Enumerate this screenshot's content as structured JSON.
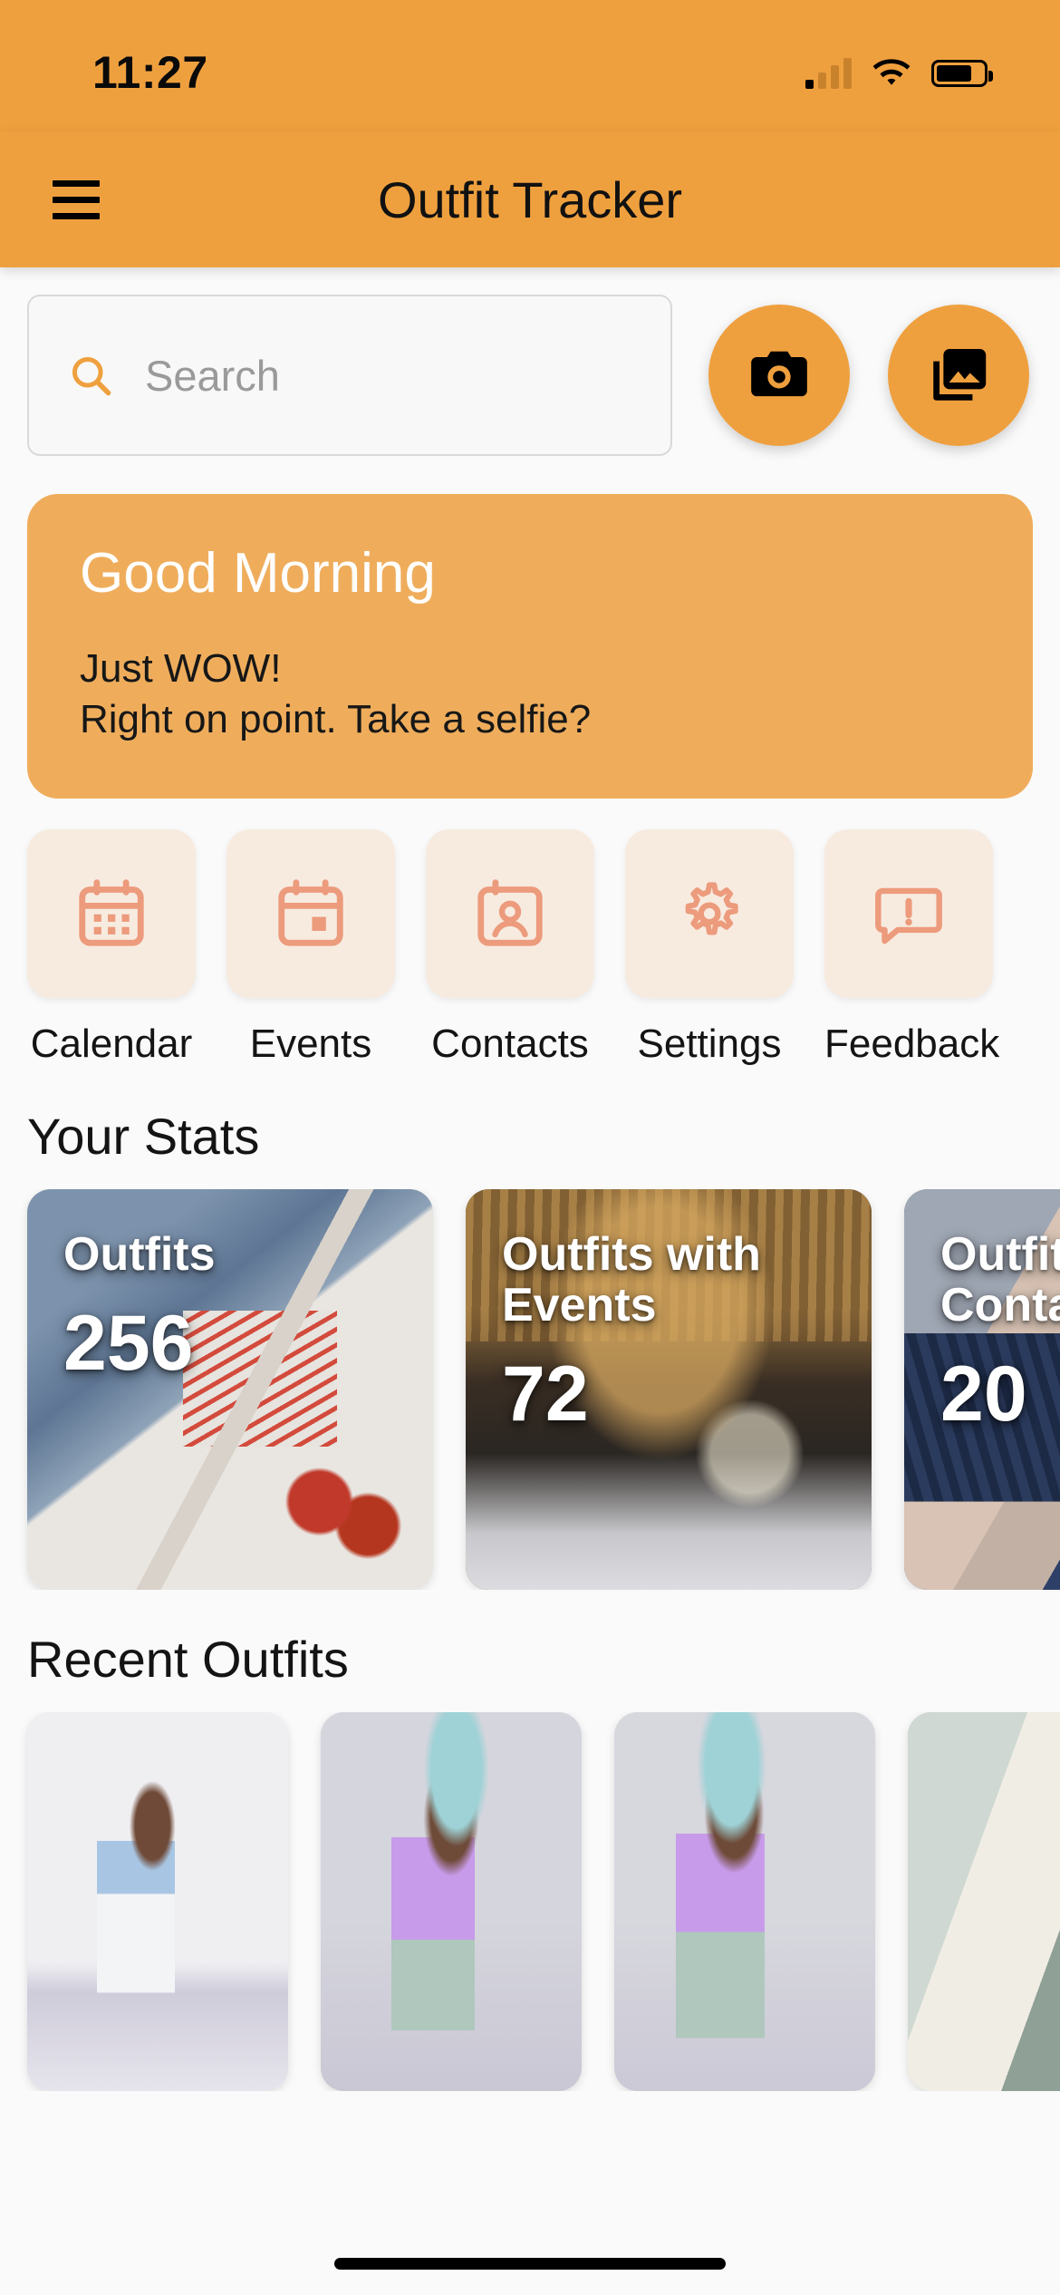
{
  "status_bar": {
    "time": "11:27",
    "signal_icon": "cellular-signal-icon",
    "signal_bars_filled": 1,
    "wifi_icon": "wifi-icon",
    "battery_icon": "battery-icon",
    "battery_level_percent": 76
  },
  "app_bar": {
    "menu_icon": "hamburger-menu-icon",
    "title": "Outfit Tracker",
    "background_color": "#EFA03E"
  },
  "search": {
    "placeholder": "Search",
    "value": "",
    "icon": "search-icon",
    "icon_color": "#EFA03E"
  },
  "actions": [
    {
      "name": "camera-button",
      "icon": "camera-icon"
    },
    {
      "name": "gallery-button",
      "icon": "photo-library-icon"
    }
  ],
  "greeting": {
    "title": "Good Morning",
    "line1": "Just WOW!",
    "line2": "Right on point. Take a selfie?",
    "background_color": "#EFAD5C",
    "title_color": "#FFFFFF"
  },
  "quick_actions": [
    {
      "label": "Calendar",
      "icon": "calendar-icon"
    },
    {
      "label": "Events",
      "icon": "calendar-event-icon"
    },
    {
      "label": "Contacts",
      "icon": "contact-card-icon"
    },
    {
      "label": "Settings",
      "icon": "gear-icon"
    },
    {
      "label": "Feedback",
      "icon": "feedback-bubble-icon"
    }
  ],
  "stats": {
    "section_title": "Your Stats",
    "cards": [
      {
        "label": "Outfits",
        "value": "256",
        "photo": "clothing-flatlay-photo"
      },
      {
        "label": "Outfits with Events",
        "value": "72",
        "photo": "banquet-event-photo"
      },
      {
        "label": "Outfits with Contacts",
        "value": "20",
        "photo": "desk-laptop-photo"
      }
    ]
  },
  "recent": {
    "section_title": "Recent Outfits",
    "items": [
      {
        "name": "outfit-thumbnail-1",
        "photo": "blue-top-white-jeans-selfie"
      },
      {
        "name": "outfit-thumbnail-2",
        "photo": "purple-top-mint-skirt-selfie"
      },
      {
        "name": "outfit-thumbnail-3",
        "photo": "purple-top-mint-skirt-selfie-2"
      },
      {
        "name": "outfit-thumbnail-4",
        "photo": "mirror-selfie-partial"
      }
    ]
  },
  "home_indicator": "home-indicator"
}
